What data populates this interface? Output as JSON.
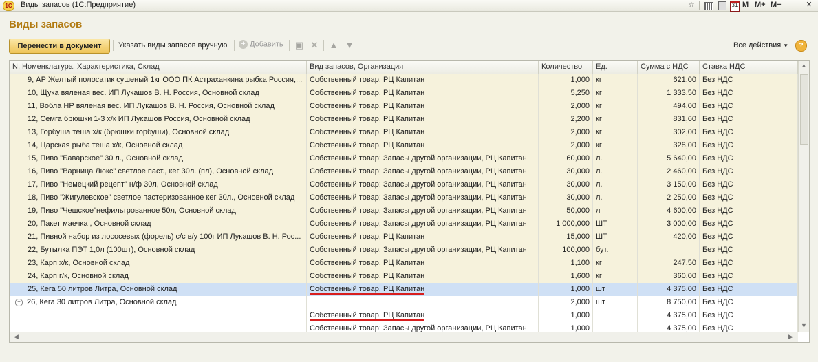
{
  "window": {
    "logo": "1С",
    "title": "Виды запасов  (1С:Предприятие)",
    "icons": [
      "star-icon",
      "grid-icon",
      "calculator-icon",
      "calendar-icon"
    ],
    "calendar_day": "31",
    "memory_buttons": [
      "M",
      "M+",
      "M−"
    ],
    "close_glyph": "✕"
  },
  "form": {
    "title": "Виды запасов"
  },
  "toolbar": {
    "transfer_label": "Перенести в документ",
    "manual_label": "Указать виды запасов вручную",
    "add_label": "Добавить",
    "all_actions_label": "Все действия",
    "help_label": "?"
  },
  "table": {
    "columns": [
      "N, Номенклатура, Характеристика, Склад",
      "Вид запасов, Организация",
      "Количество",
      "Ед.",
      "Сумма с НДС",
      "Ставка НДС"
    ],
    "rows": [
      {
        "item": "9, АР Желтый полосатик сушеный 1кг ООО ПК Астраханкина рыбка Россия,...",
        "kind": "Собственный товар, РЦ Капитан",
        "qty": "1,000",
        "unit": "кг",
        "sum": "621,00",
        "vat": "Без НДС"
      },
      {
        "item": "10, Щука вяленая вес. ИП Лукашов В. Н. Россия, Основной склад",
        "kind": "Собственный товар, РЦ Капитан",
        "qty": "5,250",
        "unit": "кг",
        "sum": "1 333,50",
        "vat": "Без НДС"
      },
      {
        "item": "11, Вобла НР вяленая вес. ИП Лукашов В. Н. Россия, Основной склад",
        "kind": "Собственный товар, РЦ Капитан",
        "qty": "2,000",
        "unit": "кг",
        "sum": "494,00",
        "vat": "Без НДС"
      },
      {
        "item": "12, Семга брюшки 1-3  х/к ИП Лукашов Россия, Основной склад",
        "kind": "Собственный товар, РЦ Капитан",
        "qty": "2,200",
        "unit": "кг",
        "sum": "831,60",
        "vat": "Без НДС"
      },
      {
        "item": "13, Горбуша теша х/к (брюшки горбуши), Основной склад",
        "kind": "Собственный товар, РЦ Капитан",
        "qty": "2,000",
        "unit": "кг",
        "sum": "302,00",
        "vat": "Без НДС"
      },
      {
        "item": "14, Царская рыба теша х/к, Основной склад",
        "kind": "Собственный товар, РЦ Капитан",
        "qty": "2,000",
        "unit": "кг",
        "sum": "328,00",
        "vat": "Без НДС"
      },
      {
        "item": "15, Пиво \"Баварское\" 30 л., Основной склад",
        "kind": "Собственный товар; Запасы другой организации, РЦ Капитан",
        "qty": "60,000",
        "unit": "л.",
        "sum": "5 640,00",
        "vat": "Без НДС"
      },
      {
        "item": "16, Пиво \"Варница Люкс\" светлое паст., кег 30л. (пл), Основной склад",
        "kind": "Собственный товар; Запасы другой организации, РЦ Капитан",
        "qty": "30,000",
        "unit": "л.",
        "sum": "2 460,00",
        "vat": "Без НДС"
      },
      {
        "item": "17, Пиво \"Немецкий рецепт\" н/ф 30л, Основной склад",
        "kind": "Собственный товар; Запасы другой организации, РЦ Капитан",
        "qty": "30,000",
        "unit": "л.",
        "sum": "3 150,00",
        "vat": "Без НДС"
      },
      {
        "item": "18, Пиво \"Жигулевское\" светлое пастеризованное кег 30л., Основной склад",
        "kind": "Собственный товар; Запасы другой организации, РЦ Капитан",
        "qty": "30,000",
        "unit": "л.",
        "sum": "2 250,00",
        "vat": "Без НДС"
      },
      {
        "item": "19, Пиво \"Чешское\"нефильтрованное 50л, Основной склад",
        "kind": "Собственный товар; Запасы другой организации, РЦ Капитан",
        "qty": "50,000",
        "unit": "л",
        "sum": "4 600,00",
        "vat": "Без НДС"
      },
      {
        "item": "20, Пакет маечка , Основной склад",
        "kind": "Собственный товар; Запасы другой организации, РЦ Капитан",
        "qty": "1 000,000",
        "unit": "ШТ",
        "sum": "3 000,00",
        "vat": "Без НДС"
      },
      {
        "item": "21, Пивной набор из лососевых (форель) с/с в/у 100г ИП Лукашов В. Н. Рос...",
        "kind": "Собственный товар, РЦ Капитан",
        "qty": "15,000",
        "unit": "ШТ",
        "sum": "420,00",
        "vat": "Без НДС"
      },
      {
        "item": "22, Бутылка ПЭТ 1,0л (100шт), Основной склад",
        "kind": "Собственный товар; Запасы другой организации, РЦ Капитан",
        "qty": "100,000",
        "unit": "бут.",
        "sum": "",
        "vat": "Без НДС"
      },
      {
        "item": "23, Карп х/к, Основной склад",
        "kind": "Собственный товар, РЦ Капитан",
        "qty": "1,100",
        "unit": "кг",
        "sum": "247,50",
        "vat": "Без НДС"
      },
      {
        "item": "24, Карп г/к, Основной склад",
        "kind": "Собственный товар, РЦ Капитан",
        "qty": "1,600",
        "unit": "кг",
        "sum": "360,00",
        "vat": "Без НДС"
      },
      {
        "item": "25, Кега 50 литров Литра, Основной склад",
        "kind": "Собственный товар, РЦ Капитан",
        "qty": "1,000",
        "unit": "шт",
        "sum": "4 375,00",
        "vat": "Без НДС"
      },
      {
        "item": "26, Кега 30 литров Литра, Основной склад",
        "kind": "",
        "qty": "2,000",
        "unit": "шт",
        "sum": "8 750,00",
        "vat": "Без НДС"
      },
      {
        "item": "",
        "kind": "Собственный товар, РЦ Капитан",
        "qty": "1,000",
        "unit": "",
        "sum": "4 375,00",
        "vat": "Без НДС"
      },
      {
        "item": "",
        "kind": "Собственный товар; Запасы другой организации, РЦ Капитан",
        "qty": "1,000",
        "unit": "",
        "sum": "4 375,00",
        "vat": "Без НДС"
      }
    ]
  }
}
